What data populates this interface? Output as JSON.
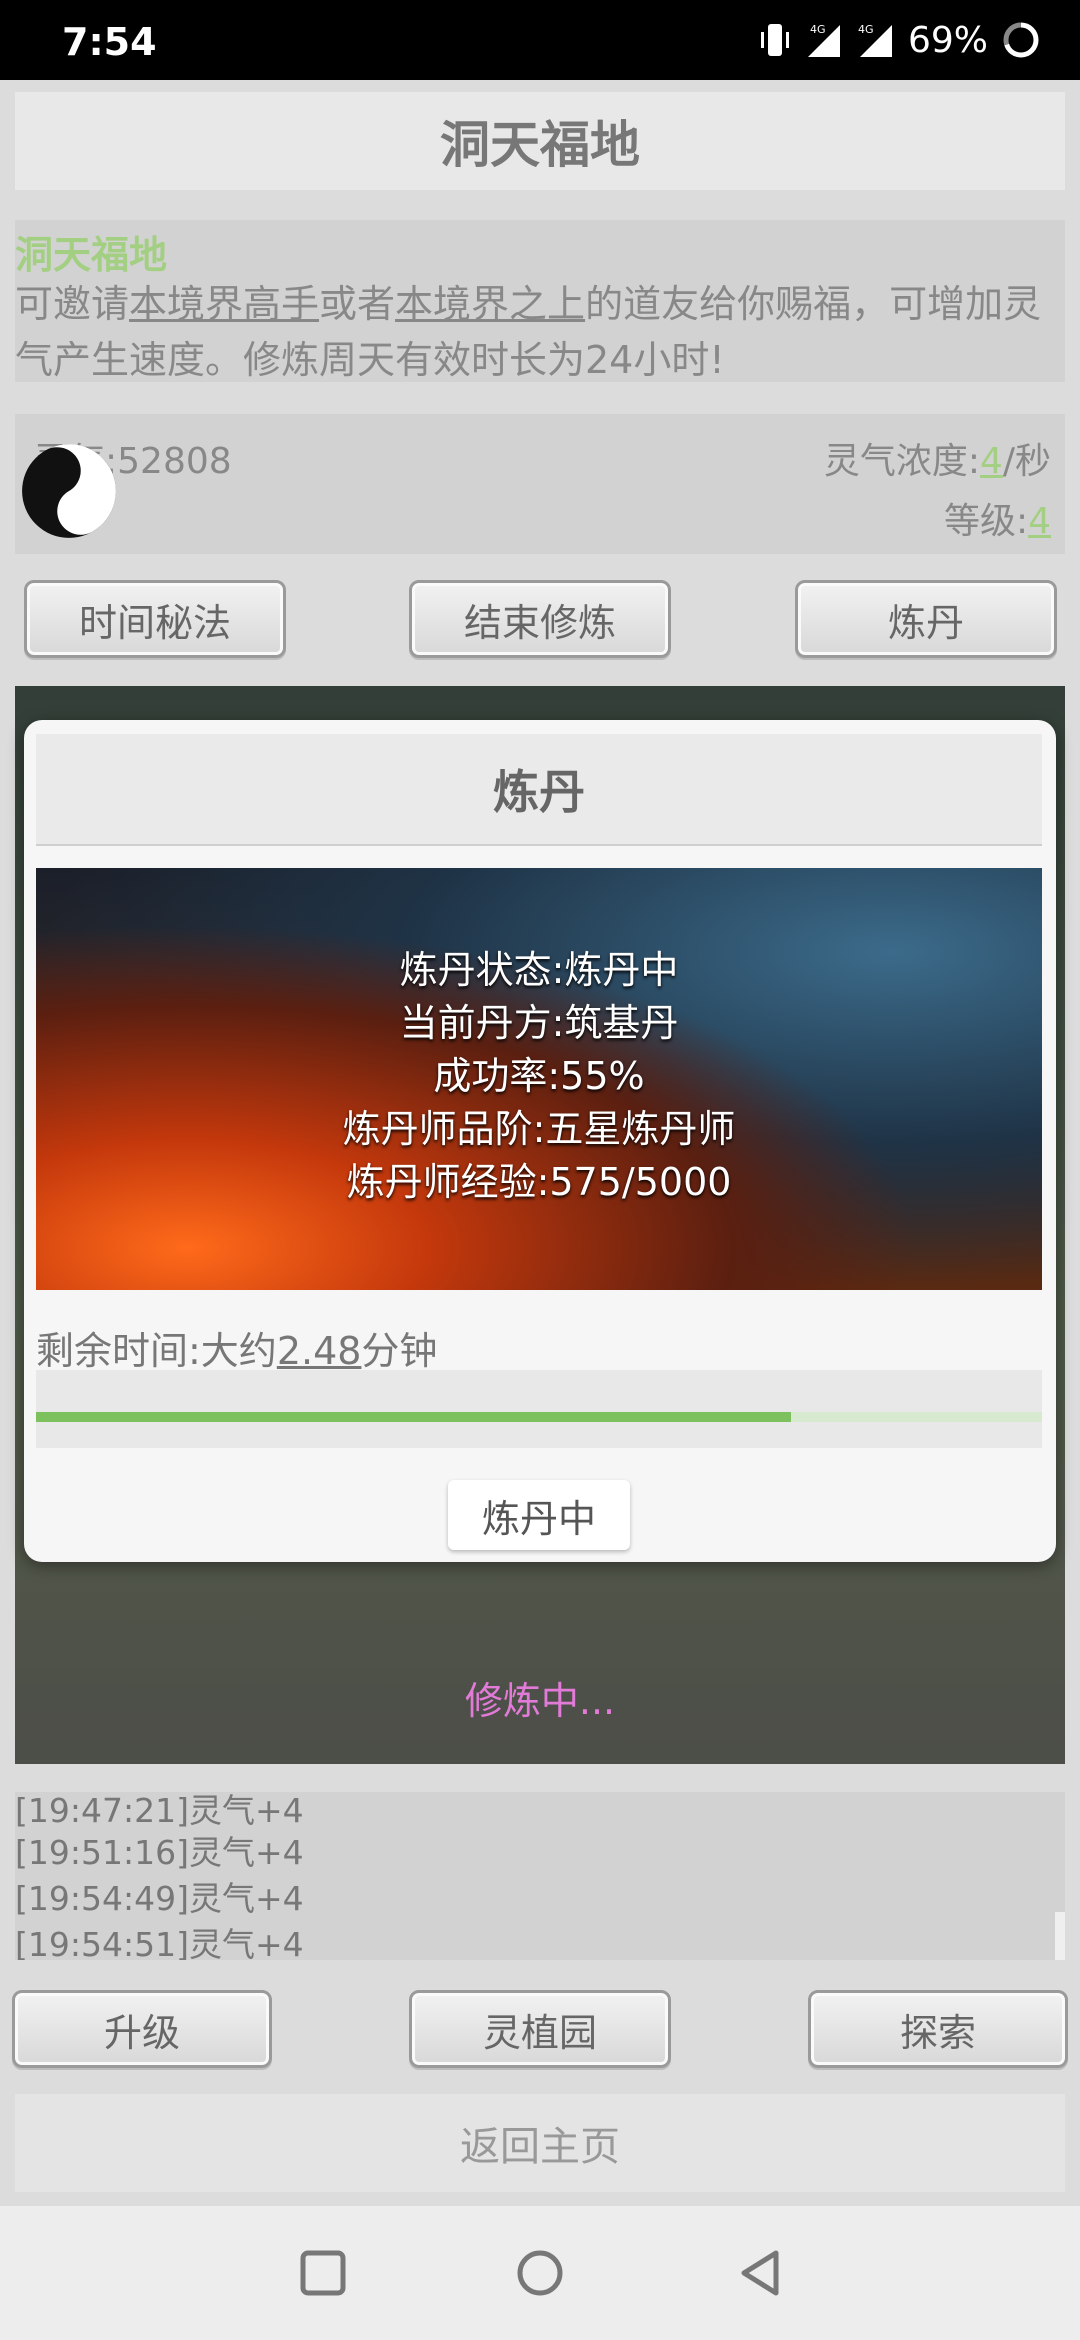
{
  "status_bar": {
    "time": "7:54",
    "network_1": "4G",
    "network_2": "4G",
    "battery": "69%",
    "icons": [
      "vibrate-icon",
      "signal-icon",
      "signal-icon",
      "battery-ring-icon"
    ]
  },
  "header": {
    "title": "洞天福地"
  },
  "info": {
    "title": "洞天福地",
    "desc_1": "可邀请",
    "link_1": "本境界高手",
    "desc_2": "或者",
    "link_2": "本境界之上",
    "desc_3": "的道友给你赐福，可增加灵气产生速度。修炼周天有效时长为24小时!"
  },
  "stats": {
    "qi_label": "灵气:52808",
    "density_label": "灵气浓度:",
    "density_value": "4",
    "density_unit": "/秒",
    "level_label": "等级:",
    "level_value": "4"
  },
  "top_buttons": {
    "time_secret": "时间秘法",
    "end_cultivation": "结束修炼",
    "alchemy": "炼丹"
  },
  "modal": {
    "title": "炼丹",
    "status": "炼丹状态:炼丹中",
    "recipe": "当前丹方:筑基丹",
    "success_rate": "成功率:55%",
    "rank": "炼丹师品阶:五星炼丹师",
    "exp": "炼丹师经验:575/5000",
    "remaining_prefix": "剩余时间:大约",
    "remaining_value": "2.48",
    "remaining_unit": "分钟",
    "progress": 0.75,
    "button": "炼丹中"
  },
  "scene": {
    "status_text": "修炼中..."
  },
  "log": [
    "[19:47:21]灵气+4",
    "[19:51:16]灵气+4",
    "[19:54:49]灵气+4",
    "[19:54:51]灵气+4"
  ],
  "bottom_buttons": {
    "upgrade": "升级",
    "garden": "灵植园",
    "explore": "探索"
  },
  "home_button": "返回主页",
  "colors": {
    "accent_green": "#a3cf82",
    "progress_green": "#7cc15d",
    "cultivating_pink": "#e27ad8"
  }
}
